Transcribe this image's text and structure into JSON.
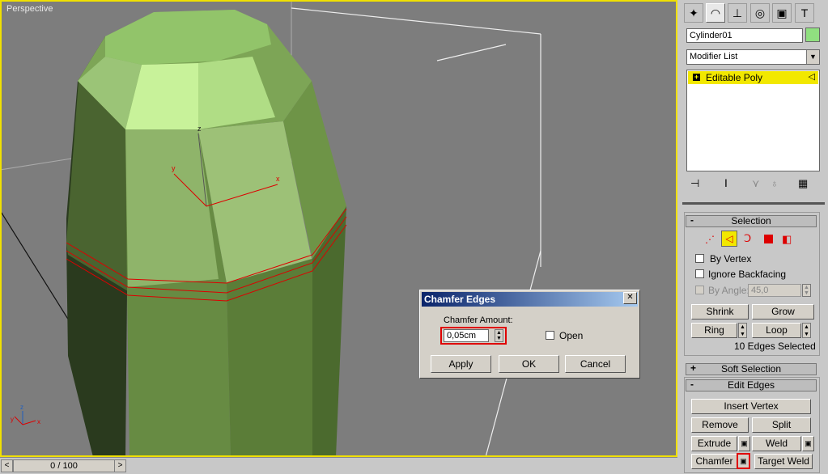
{
  "viewport": {
    "label": "Perspective"
  },
  "timeline": {
    "frame": "0 / 100",
    "prev": "<",
    "next": ">"
  },
  "panel": {
    "object_name": "Cylinder01",
    "object_color": "#90e080",
    "modifier_list": "Modifier List",
    "stack_item": "Editable Poly",
    "stack_expand": "+",
    "selection": {
      "header": "Selection",
      "by_vertex": "By Vertex",
      "ignore_backfacing": "Ignore Backfacing",
      "by_angle": "By Angle:",
      "by_angle_value": "45,0",
      "shrink": "Shrink",
      "grow": "Grow",
      "ring": "Ring",
      "loop": "Loop",
      "status": "10 Edges Selected"
    },
    "soft_selection": {
      "header": "Soft Selection"
    },
    "edit_edges": {
      "header": "Edit Edges",
      "insert_vertex": "Insert Vertex",
      "remove": "Remove",
      "split": "Split",
      "extrude": "Extrude",
      "weld": "Weld",
      "chamfer": "Chamfer",
      "target_weld": "Target Weld"
    }
  },
  "dialog": {
    "title": "Chamfer Edges",
    "close": "✕",
    "amount_label": "Chamfer Amount:",
    "amount_value": "0,05cm",
    "open_label": "Open",
    "apply": "Apply",
    "ok": "OK",
    "cancel": "Cancel"
  },
  "colors": {
    "highlight": "#e8e000",
    "selection_red": "#e00000",
    "title_bar": "#0a246a"
  }
}
